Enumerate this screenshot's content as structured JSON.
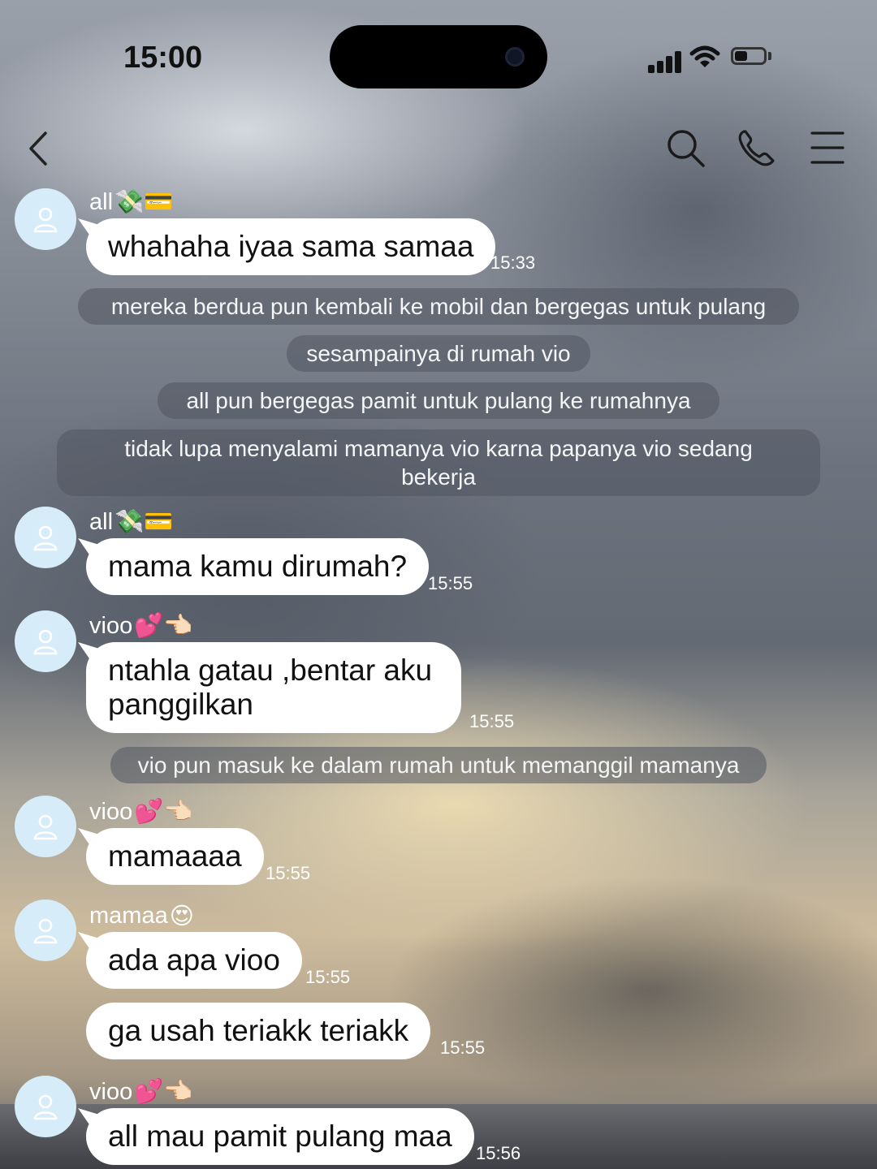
{
  "status_bar": {
    "time": "15:00",
    "battery_level": 0.45
  },
  "nav": {
    "icons": [
      "back-chevron-icon",
      "search-icon",
      "phone-icon",
      "menu-icon"
    ]
  },
  "messages": [
    {
      "kind": "sender",
      "name": "all",
      "emoji": "💸💳"
    },
    {
      "kind": "bubble",
      "text": "whahaha iyaa sama samaa",
      "time": "15:33"
    },
    {
      "kind": "narration",
      "text": "mereka berdua pun kembali ke mobil dan bergegas untuk pulang"
    },
    {
      "kind": "narration",
      "text": "sesampainya di rumah vio"
    },
    {
      "kind": "narration",
      "text": "all pun bergegas pamit untuk pulang ke rumahnya"
    },
    {
      "kind": "narration",
      "text": "tidak lupa menyalami mamanya vio karna papanya vio sedang bekerja"
    },
    {
      "kind": "sender",
      "name": "all",
      "emoji": "💸💳"
    },
    {
      "kind": "bubble",
      "text": "mama kamu dirumah?",
      "time": "15:55"
    },
    {
      "kind": "sender",
      "name": "vioo",
      "emoji": "💕👈🏻"
    },
    {
      "kind": "bubble",
      "text": "ntahla gatau ,bentar aku panggilkan",
      "time": "15:55"
    },
    {
      "kind": "narration",
      "text": "vio pun masuk ke dalam rumah untuk memanggil mamanya"
    },
    {
      "kind": "sender",
      "name": "vioo",
      "emoji": "💕👈🏻"
    },
    {
      "kind": "bubble",
      "text": "mamaaaa",
      "time": "15:55"
    },
    {
      "kind": "sender",
      "name": "mamaa",
      "emoji": "😍"
    },
    {
      "kind": "bubble",
      "text": "ada apa vioo",
      "time": "15:55"
    },
    {
      "kind": "bubble",
      "text": "ga usah teriakk teriakk",
      "time": "15:55"
    },
    {
      "kind": "sender",
      "name": "vioo",
      "emoji": "💕👈🏻"
    },
    {
      "kind": "bubble",
      "text": "all mau pamit pulang maa",
      "time": "15:56"
    }
  ],
  "colors": {
    "avatar_bg": "#d6ecf9",
    "avatar_icon": "#ffffff",
    "bubble_bg": "#ffffff",
    "narration_bg": "#50566080"
  }
}
